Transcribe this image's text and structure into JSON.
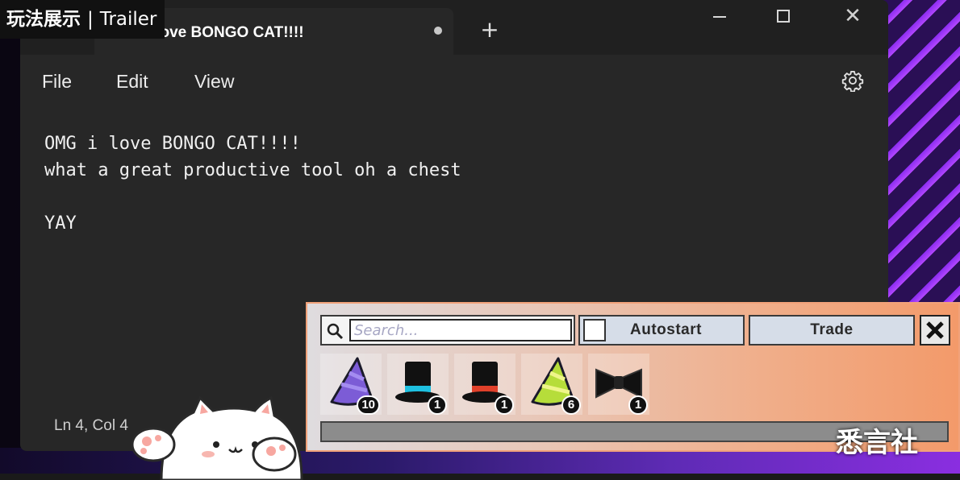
{
  "overlay": {
    "tag": "玩法展示",
    "separator": "|",
    "subtitle": "Trailer"
  },
  "tab": {
    "title": "OMG i love BONGO CAT!!!!",
    "new_tab_symbol": "+"
  },
  "window_controls": {
    "close_symbol": "✕"
  },
  "menu": {
    "items": [
      "File",
      "Edit",
      "View"
    ]
  },
  "editor": {
    "lines": [
      "OMG i love BONGO CAT!!!!",
      "what a great productive tool oh a chest",
      "",
      "YAY"
    ]
  },
  "status": {
    "position": "Ln 4, Col 4"
  },
  "bongo_panel": {
    "search_placeholder": "Search...",
    "autostart_label": "Autostart",
    "autostart_checked": false,
    "trade_label": "Trade",
    "close_symbol": "✕",
    "inventory": [
      {
        "icon": "purple-party-hat-icon",
        "count": "10",
        "color": "#7c5cd6"
      },
      {
        "icon": "top-hat-blue-band-icon",
        "count": "1",
        "color": "#1ec0e0"
      },
      {
        "icon": "top-hat-red-band-icon",
        "count": "1",
        "color": "#e0402a"
      },
      {
        "icon": "green-party-hat-icon",
        "count": "6",
        "color": "#b6dd3a"
      },
      {
        "icon": "black-bowtie-icon",
        "count": "1",
        "color": "#111111"
      }
    ],
    "progress": 0.0
  },
  "watermark": "悉言社"
}
